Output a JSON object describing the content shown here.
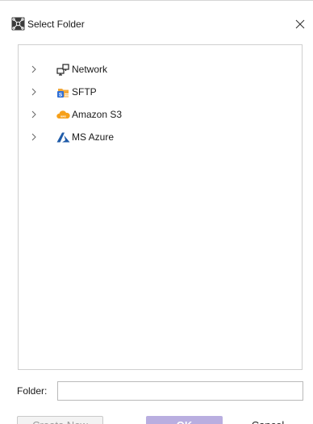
{
  "dialog": {
    "title": "Select Folder",
    "app_icon": "network-grid-icon",
    "close_icon": "close-icon"
  },
  "tree": {
    "items": [
      {
        "label": "Network",
        "icon": "network-computer-icon",
        "expanded": false
      },
      {
        "label": "SFTP",
        "icon": "sftp-icon",
        "expanded": false
      },
      {
        "label": "Amazon S3",
        "icon": "amazon-s3-icon",
        "expanded": false
      },
      {
        "label": "MS Azure",
        "icon": "ms-azure-icon",
        "expanded": false
      }
    ]
  },
  "folder_field": {
    "label": "Folder:",
    "value": "",
    "placeholder": ""
  },
  "buttons": {
    "new_label": "Create New",
    "ok_label": "OK",
    "cancel_label": "Cancel"
  },
  "colors": {
    "ok_button_bg": "#b9aee0",
    "amazon_orange": "#f6a01a",
    "azure_blue": "#1f5ba8",
    "sftp_blue": "#2f6fd6"
  }
}
